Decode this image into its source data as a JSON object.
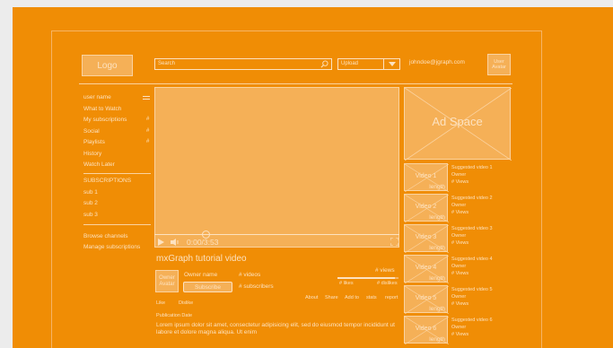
{
  "header": {
    "logo": "Logo",
    "search_placeholder": "Search",
    "upload_label": "Upload",
    "email": "johndoe@jgraph.com",
    "avatar": "User Avatar"
  },
  "sidebar": {
    "items": [
      {
        "label": "user name",
        "hash": ""
      },
      {
        "label": "What to Watch",
        "hash": ""
      },
      {
        "label": "My subscriptions",
        "hash": "#"
      },
      {
        "label": "Social",
        "hash": "#"
      },
      {
        "label": "Playlists",
        "hash": "#"
      },
      {
        "label": "History",
        "hash": ""
      },
      {
        "label": "Watch Later",
        "hash": ""
      }
    ],
    "subscriptions_heading": "SUBSCRIPTIONS",
    "subs": [
      "sub 1",
      "sub 2",
      "sub 3"
    ],
    "browse": "Browse channels",
    "manage": "Manage subscriptions"
  },
  "player": {
    "time": "0:00/3:53",
    "progress": 0.21
  },
  "video_info": {
    "title": "mxGraph tutorial video",
    "owner_avatar": "Owner Avatar",
    "owner_name": "Owner name",
    "videos": "# videos",
    "subscribe": "Subscribe",
    "subscribers": "# subscribers",
    "views": "# views",
    "likes": "# likes",
    "dislikes": "# dislikes",
    "like": "Like",
    "dislike": "Dislike",
    "actions": [
      "About",
      "Share",
      "Add to",
      "stats",
      "report"
    ],
    "publication": "Publication Date",
    "description": "Lorem ipsum dolor sit amet, consectetur adipisicing elit, sed do eiusmod tempor incididunt ut labore et dolore magna aliqua. Ut enim"
  },
  "ad": {
    "label": "Ad Space"
  },
  "suggestions": [
    {
      "video": "Video 1",
      "length": "length",
      "title": "Suggested video 1",
      "owner": "Owner",
      "views": "# Views"
    },
    {
      "video": "Video 2",
      "length": "length",
      "title": "Suggested video 2",
      "owner": "Owner",
      "views": "# Views"
    },
    {
      "video": "Video 3",
      "length": "length",
      "title": "Suggested video 3",
      "owner": "Owner",
      "views": "# Views"
    },
    {
      "video": "Video 4",
      "length": "length",
      "title": "Suggested video 4",
      "owner": "Owner",
      "views": "# Views"
    },
    {
      "video": "Video 5",
      "length": "length",
      "title": "Suggested video 5",
      "owner": "Owner",
      "views": "# Views"
    },
    {
      "video": "Video 6",
      "length": "length",
      "title": "Suggested video 6",
      "owner": "Owner",
      "views": "# Views"
    }
  ],
  "colors": {
    "background": "#f08d05",
    "placeholder": "#f5b057",
    "text": "#fde2c0"
  }
}
